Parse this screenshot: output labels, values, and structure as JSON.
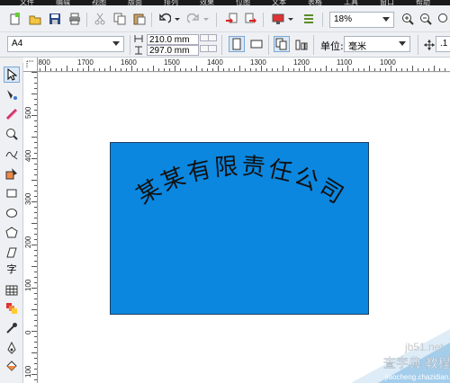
{
  "menubar": {
    "items": [
      "文件",
      "编辑",
      "视图",
      "版面",
      "排列",
      "效果",
      "位图",
      "文本",
      "表格",
      "工具",
      "窗口",
      "帮助"
    ]
  },
  "standard_toolbar": {
    "zoom": "18%"
  },
  "property_bar": {
    "paper_size": "A4",
    "width": "210.0 mm",
    "height": "297.0 mm",
    "units_label": "单位:",
    "units_value": "毫米",
    "nudge": ".1 r"
  },
  "rulers": {
    "horizontal_labels": [
      "1800",
      "1700",
      "1600",
      "1500",
      "1400",
      "1300",
      "1200",
      "1100",
      "1000"
    ],
    "vertical_labels": [
      "500",
      "400",
      "300",
      "200",
      "100",
      "0",
      "100"
    ]
  },
  "toolbox": {
    "text_tool_glyph": "字"
  },
  "document": {
    "arc_text": "某某有限责任公司",
    "rect_color": "#0b87e0"
  },
  "watermark": {
    "site": "jb51.net",
    "title": "查字典 教程网",
    "url": "jiaocheng.chazidian.com"
  }
}
